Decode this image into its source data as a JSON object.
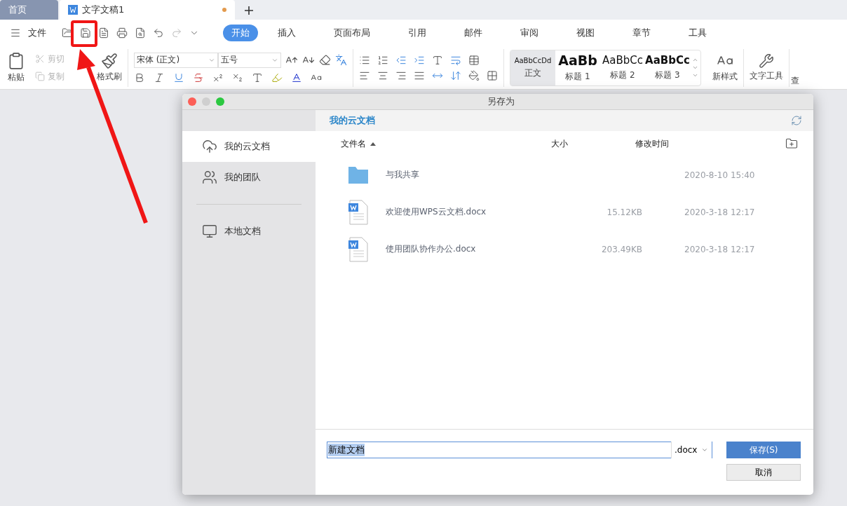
{
  "tabs": [
    {
      "label": "首页",
      "selected": false,
      "modified": false
    },
    {
      "label": "文字文稿1",
      "selected": true,
      "modified": true
    }
  ],
  "menu": {
    "file": "文件",
    "ribbon_tabs": [
      {
        "label": "开始",
        "selected": true
      },
      {
        "label": "插入",
        "selected": false
      },
      {
        "label": "页面布局",
        "selected": false
      },
      {
        "label": "引用",
        "selected": false
      },
      {
        "label": "邮件",
        "selected": false
      },
      {
        "label": "审阅",
        "selected": false
      },
      {
        "label": "视图",
        "selected": false
      },
      {
        "label": "章节",
        "selected": false
      },
      {
        "label": "工具",
        "selected": false
      }
    ]
  },
  "ribbon": {
    "paste": "粘贴",
    "cut": {
      "label": "剪切",
      "disabled": true
    },
    "copy": {
      "label": "复制",
      "disabled": true
    },
    "format_painter": "格式刷",
    "font": "宋体 (正文)",
    "font_size": "五号",
    "styles": [
      {
        "preview": "AaBbCcDd",
        "label": "正文",
        "selected": true,
        "kind": "body"
      },
      {
        "preview": "AaBb",
        "label": "标题 1",
        "selected": false,
        "kind": "h1"
      },
      {
        "preview": "AaBbCc",
        "label": "标题 2",
        "selected": false,
        "kind": "h2"
      },
      {
        "preview": "AaBbCc",
        "label": "标题 3",
        "selected": false,
        "kind": "h3"
      }
    ],
    "new_style": "新样式",
    "text_tools": "文字工具",
    "find": "查"
  },
  "dialog": {
    "title": "另存为",
    "sidebar_groups": [
      [
        {
          "label": "我的云文档",
          "selected": true,
          "kind": "cloud"
        },
        {
          "label": "我的团队",
          "selected": false,
          "kind": "team"
        }
      ],
      [
        {
          "label": "本地文档",
          "selected": false,
          "kind": "local"
        }
      ]
    ],
    "location": "我的云文档",
    "columns": {
      "name": "文件名",
      "size": "大小",
      "modified": "修改时间"
    },
    "files": [
      {
        "kind": "folder",
        "name": "与我共享",
        "modified": "2020-8-10 15:40"
      },
      {
        "kind": "doc",
        "name": "欢迎使用WPS云文档.docx",
        "size": "15.12KB",
        "modified": "2020-3-18 12:17"
      },
      {
        "kind": "doc",
        "name": "使用团队协作办公.docx",
        "size": "203.49KB",
        "modified": "2020-3-18 12:17"
      }
    ],
    "filename": "新建文档",
    "format": ".docx",
    "save": "保存(S)",
    "cancel": "取消"
  }
}
